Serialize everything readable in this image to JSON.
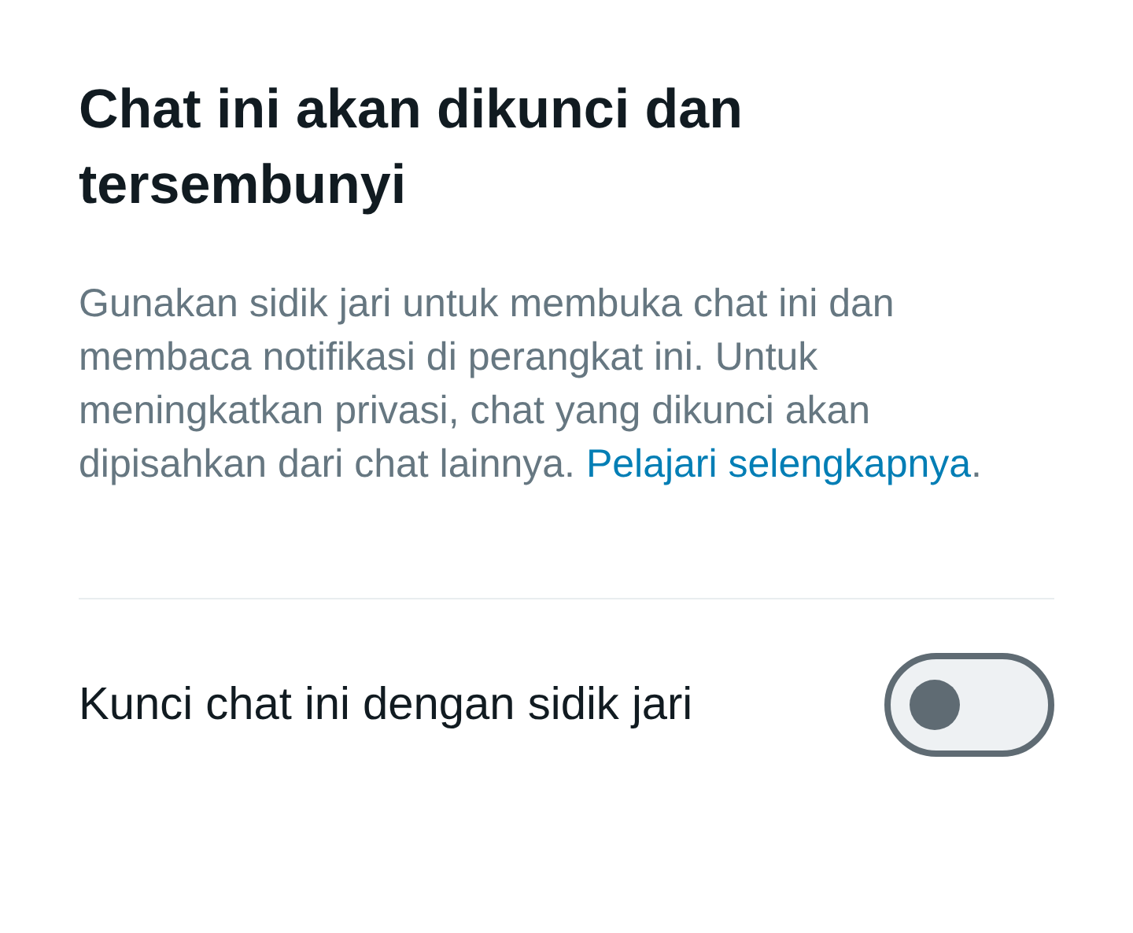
{
  "title": "Chat ini akan dikunci dan tersembunyi",
  "description": {
    "text": "Gunakan sidik jari untuk membuka chat ini dan membaca notifikasi di perangkat ini. Untuk meningkatkan privasi, chat yang dikunci akan dipisahkan dari chat lainnya.",
    "link": "Pelajari selengkapnya",
    "after": "."
  },
  "setting": {
    "label": "Kunci chat ini dengan sidik jari",
    "on": false
  }
}
